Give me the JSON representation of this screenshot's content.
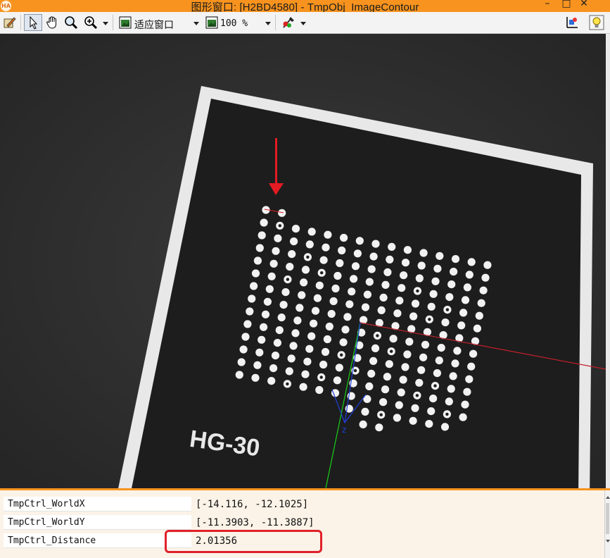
{
  "window": {
    "title": "图形窗口: [H2BD4580] - TmpObj_ImageContour",
    "app_logo_text": "HA",
    "minimize": "–",
    "maximize": "□",
    "close": "✕"
  },
  "toolbar": {
    "icons": [
      "edit-icon",
      "pointer-icon",
      "hand-pan-icon",
      "magnifier-icon",
      "zoom-in-icon",
      "fit-window-icon",
      "zoom-percent-icon",
      "paint-tool-icon",
      "coordinate-icon",
      "lightbulb-icon"
    ],
    "fit_window_label": "适应窗口",
    "zoom_value": "100 %"
  },
  "canvas": {
    "board_label": "HG-30",
    "axis_label_z": "z",
    "colors": {
      "background": "#2e2e2e",
      "board_frame": "#e8e8e8",
      "board_inner": "#1d1d1d",
      "arrow": "#e31b23",
      "axis_x": "#c0202a",
      "axis_y": "#18d018",
      "axis_z": "#1f3fd8"
    }
  },
  "properties": [
    {
      "name": "TmpCtrl_WorldX",
      "value": "[-14.116, -12.1025]"
    },
    {
      "name": "TmpCtrl_WorldY",
      "value": "[-11.3903, -11.3887]"
    },
    {
      "name": "TmpCtrl_Distance",
      "value": "2.01356"
    }
  ]
}
